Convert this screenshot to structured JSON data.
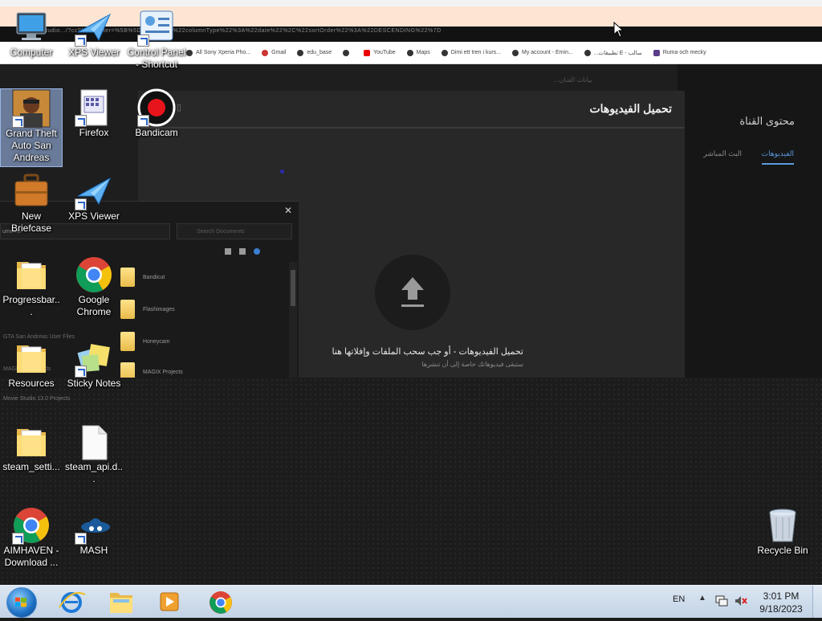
{
  "browser_backdrop": {
    "url": "...outubeStudio.../?ccSlx=1&filter=%5B%5D&sort=%7B%22columnType%22%3A%22date%22%2C%22sortOrder%22%3A%22DESCENDING%22%7D",
    "bookmarks": [
      "All Sony Xperia Pho...",
      "Gmail",
      "edu_base",
      "",
      "YouTube",
      "Maps",
      "Dimi ett tren i kurs...",
      "My account - Emin...",
      "...تطبيقات E - سالب",
      "Ruma och mecky"
    ],
    "small_title": "...بیانات الفنان",
    "channel_title": "محتوى القناة",
    "channel_tab": "الفيديوهات",
    "channel_tab2": "البث المباشر",
    "dialog_title": "تحميل الفيديوهات",
    "upload_text": "تحميل الفيديوهات - أو جب سحب الملفات وإفلاتها هنا",
    "upload_sub": "ستبقى فيديوهاتك خاصة إلى أن تنشرها"
  },
  "explorer_fragment": {
    "address": "uments",
    "search_placeholder": "Search Documents",
    "items": [
      "Bandicut",
      "Flashimages",
      "Honeycam",
      "MAGIX Projects"
    ],
    "left_texts": [
      "GTA San Andreas User Files",
      "MAGIX Downloads",
      "Movie Studio 13.0 Projects"
    ]
  },
  "desktop_icons": [
    {
      "id": "computer",
      "label": "Computer"
    },
    {
      "id": "xps-viewer-1",
      "label": "XPS Viewer"
    },
    {
      "id": "control-panel",
      "label": "Control Panel - Shortcut"
    },
    {
      "id": "gta-sa",
      "label": "Grand Theft Auto San Andreas"
    },
    {
      "id": "firefox",
      "label": "Firefox"
    },
    {
      "id": "bandicam",
      "label": "Bandicam"
    },
    {
      "id": "new-briefcase",
      "label": "New Briefcase"
    },
    {
      "id": "xps-viewer-2",
      "label": "XPS Viewer"
    },
    {
      "id": "progressbar",
      "label": "Progressbar..."
    },
    {
      "id": "google-chrome",
      "label": "Google Chrome"
    },
    {
      "id": "resources",
      "label": "Resources"
    },
    {
      "id": "sticky-notes",
      "label": "Sticky Notes"
    },
    {
      "id": "steam-settings",
      "label": "steam_setti..."
    },
    {
      "id": "steam-api",
      "label": "steam_api.d..."
    },
    {
      "id": "aimhaven",
      "label": "AIMHAVEN - Download ..."
    },
    {
      "id": "mash",
      "label": "MASH"
    },
    {
      "id": "recycle-bin",
      "label": "Recycle Bin"
    }
  ],
  "taskbar": {
    "pinned": [
      "Internet Explorer",
      "Windows Explorer",
      "Windows Media Player",
      "Google Chrome"
    ],
    "language": "EN",
    "time": "3:01 PM",
    "date": "9/18/2023"
  }
}
